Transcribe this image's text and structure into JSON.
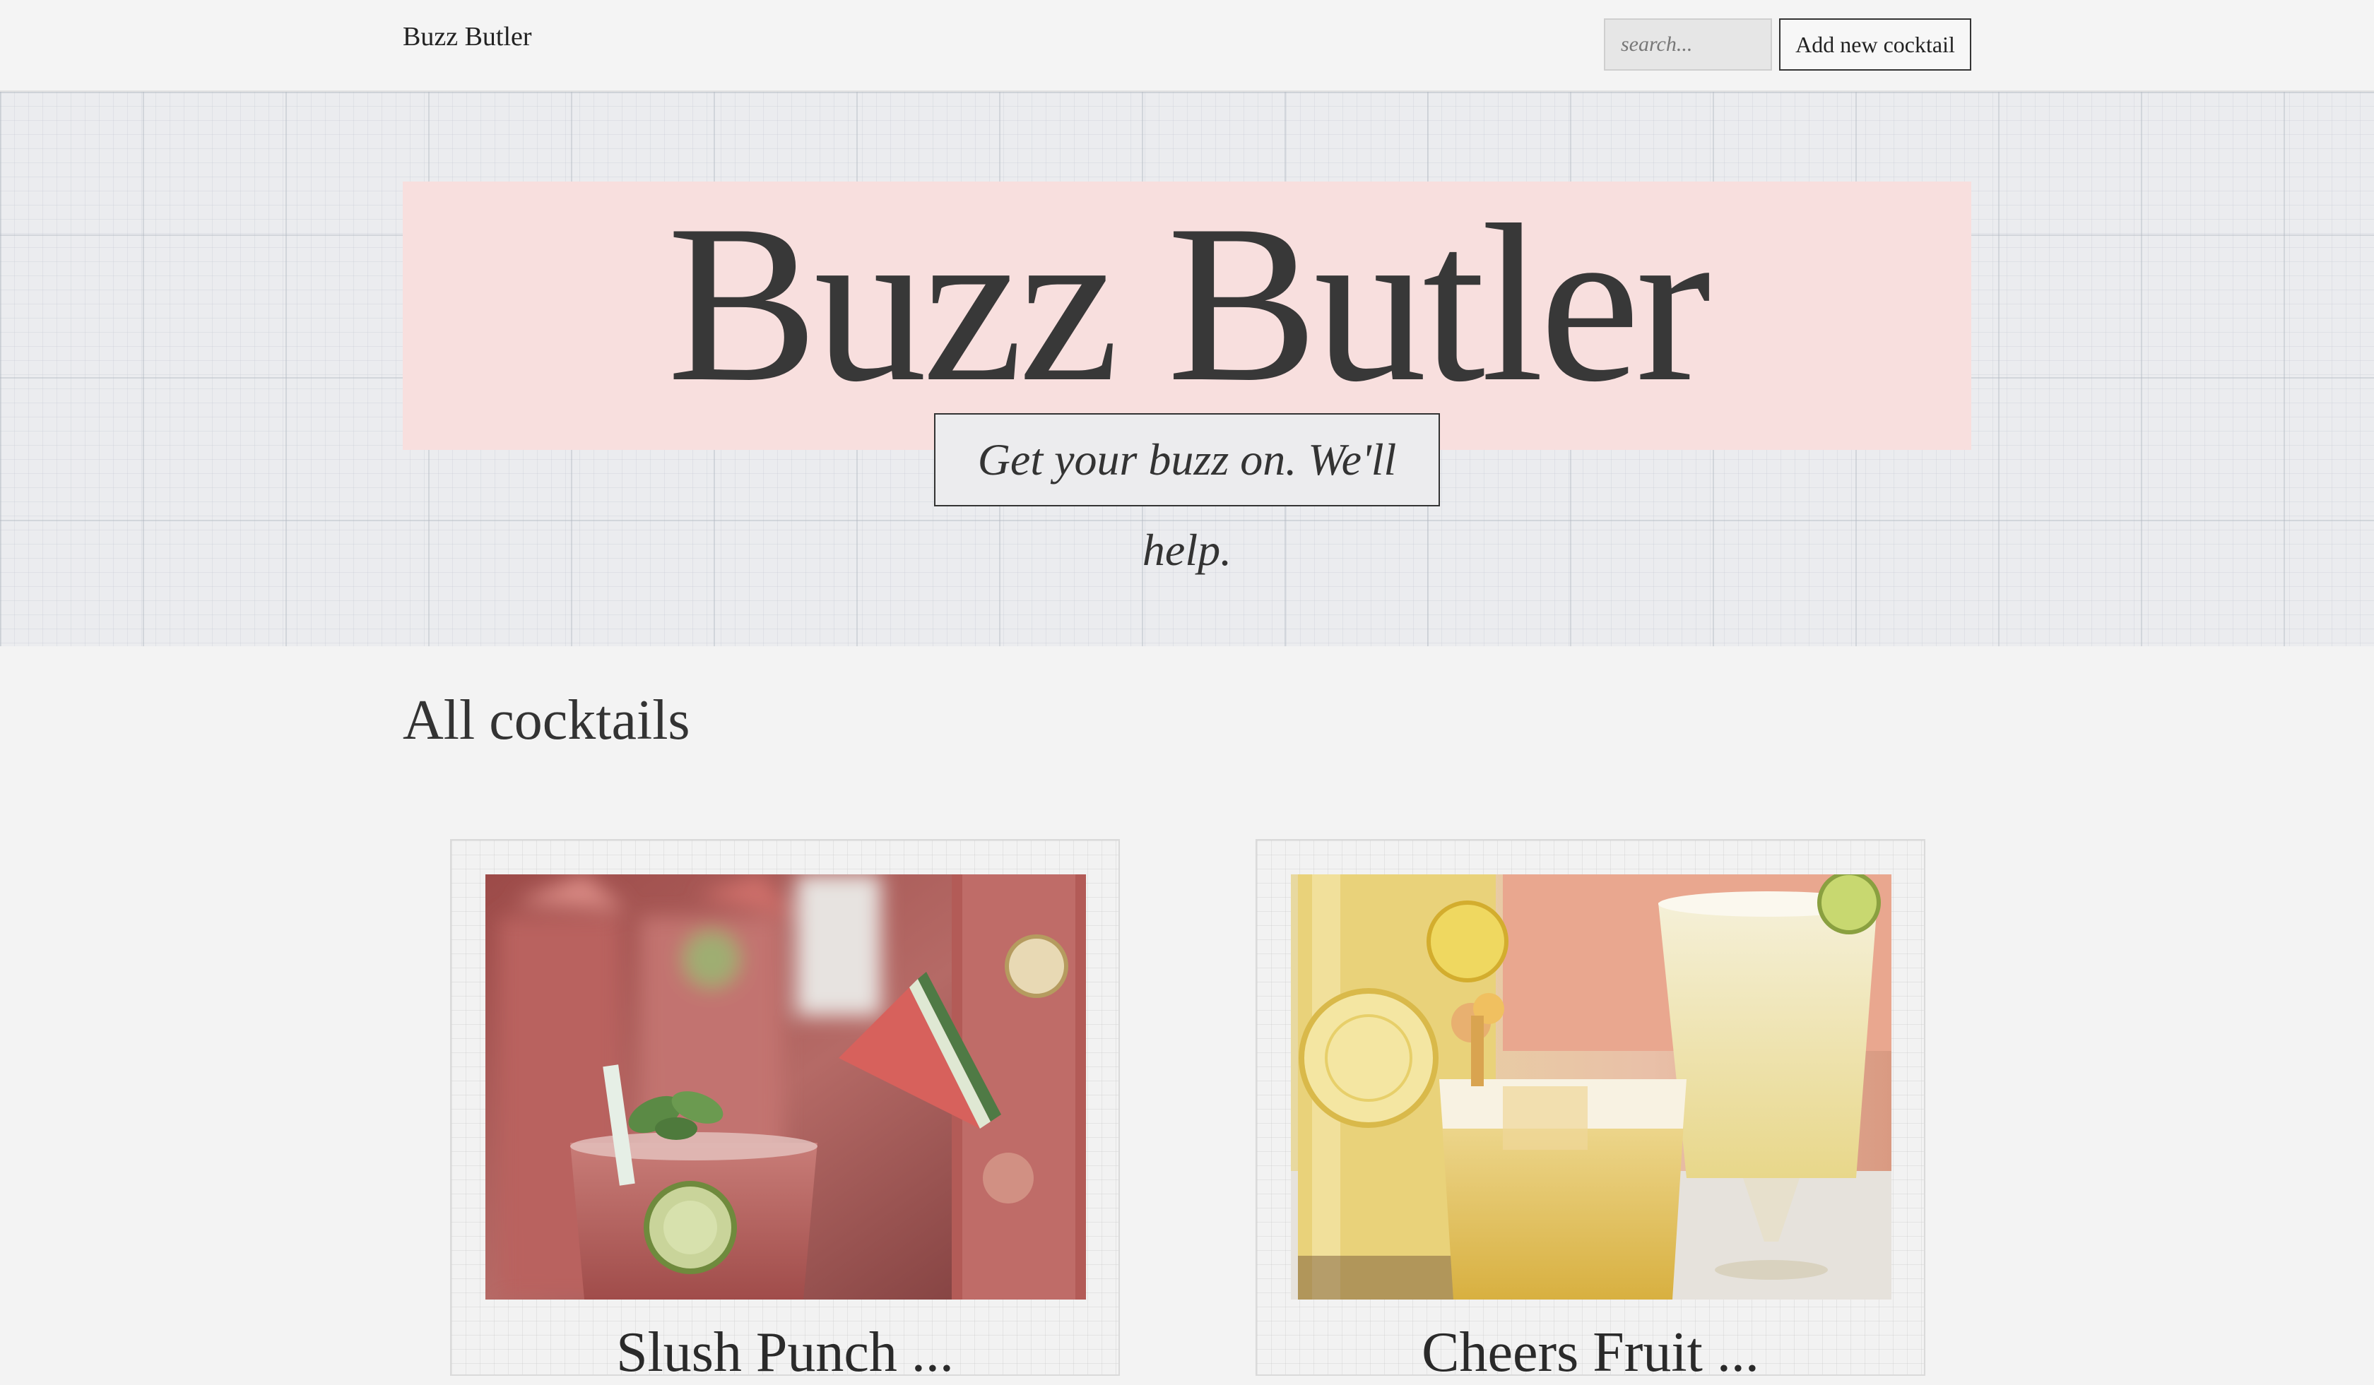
{
  "nav": {
    "brand": "Buzz Butler",
    "search_placeholder": "search...",
    "add_button_label": "Add new cocktail"
  },
  "hero": {
    "title": "Buzz Butler",
    "tagline": "Get your buzz on. We'll help."
  },
  "main": {
    "section_title": "All cocktails",
    "cocktails": [
      {
        "name": "Slush Punch ...",
        "image": "watermelon-cocktail-photo"
      },
      {
        "name": "Cheers Fruit ...",
        "image": "lemon-cocktail-photo"
      }
    ]
  },
  "colors": {
    "background": "#f3f3f3",
    "hero_band": "#f8dfde",
    "text": "#333333"
  }
}
